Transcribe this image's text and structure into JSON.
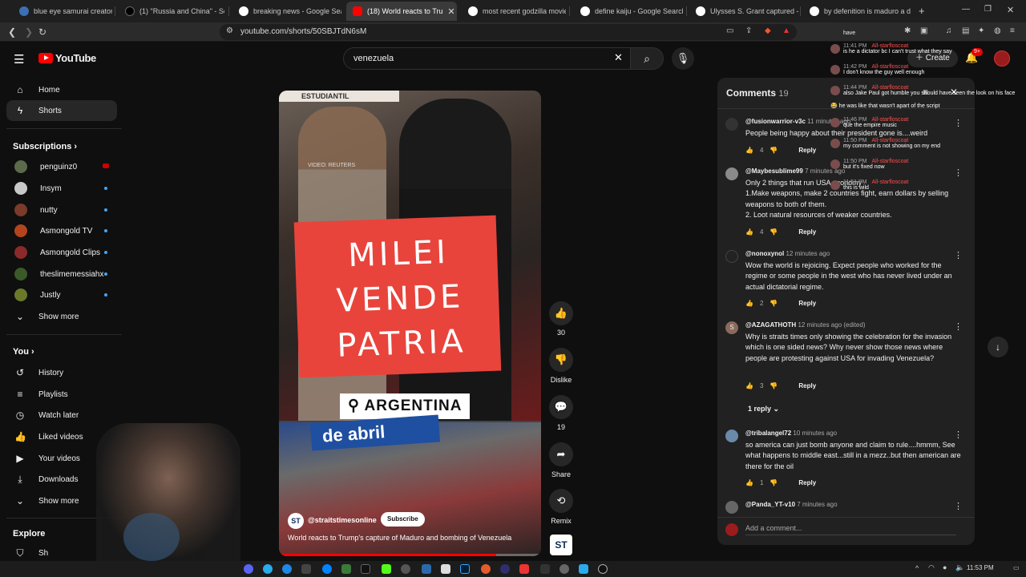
{
  "tabs": [
    {
      "label": "blue eye samurai creators also"
    },
    {
      "label": "(1) \"Russia and China\" - Search"
    },
    {
      "label": "breaking news - Google Search"
    },
    {
      "label": "(18) World reacts to Tru",
      "active": true
    },
    {
      "label": "most recent godzilla movie - G"
    },
    {
      "label": "define kaiju - Google Search"
    },
    {
      "label": "Ulysses S. Grant captured - Go"
    },
    {
      "label": "by defenition is maduro a dicta"
    }
  ],
  "address": {
    "url": "youtube.com/shorts/50SBJTdN6sM"
  },
  "header": {
    "logo_text": "YouTube",
    "search_value": "venezuela",
    "create_label": "Create",
    "notif_count": "9+"
  },
  "sidebar": {
    "main": [
      {
        "label": "Home",
        "icon": "home-icon"
      },
      {
        "label": "Shorts",
        "icon": "shorts-icon",
        "active": true
      }
    ],
    "subscriptions_title": "Subscriptions",
    "subscriptions": [
      {
        "label": "penguinz0",
        "color": "#5a6a4a",
        "live": true
      },
      {
        "label": "Insym",
        "color": "#c8c8c8"
      },
      {
        "label": "nutty",
        "color": "#7a3b2a"
      },
      {
        "label": "Asmongold TV",
        "color": "#b4441e"
      },
      {
        "label": "Asmongold Clips",
        "color": "#8a2a2a"
      },
      {
        "label": "theslimemessiahx",
        "color": "#3a5a2a"
      },
      {
        "label": "Justly",
        "color": "#6a7a2a"
      }
    ],
    "show_more": "Show more",
    "you_title": "You",
    "you": [
      {
        "label": "History",
        "icon": "history-icon"
      },
      {
        "label": "Playlists",
        "icon": "playlists-icon"
      },
      {
        "label": "Watch later",
        "icon": "watch-later-icon"
      },
      {
        "label": "Liked videos",
        "icon": "like-icon"
      },
      {
        "label": "Your videos",
        "icon": "your-videos-icon"
      },
      {
        "label": "Downloads",
        "icon": "download-icon"
      }
    ],
    "show_more_2": "Show more",
    "explore_title": "Explore",
    "explore_partial": "Sh"
  },
  "video": {
    "overlay_credit": "VIDEO: REUTERS",
    "sign_top": "ESTUDIANTIL",
    "sign_text": "MILEI VENDE PATRIA",
    "location": "ARGENTINA",
    "banner_text": "de abril",
    "channel": "@straitstimesonline",
    "subscribe": "Subscribe",
    "title": "World reacts to Trump's capture of Maduro and bombing of Venezuela"
  },
  "actions": {
    "likes": "30",
    "dislike": "Dislike",
    "comments": "19",
    "share": "Share",
    "remix": "Remix"
  },
  "comments_panel": {
    "title": "Comments",
    "count": "19",
    "add_placeholder": "Add a comment...",
    "items": [
      {
        "author": "@fusionwarrior-v3c",
        "time": "11 minutes ago",
        "text": "People being happy about their president gone is....weird",
        "likes": "4",
        "reply": "Reply",
        "avatar": "#555"
      },
      {
        "author": "@Maybesublime99",
        "time": "7 minutes ago",
        "text": "Only 2 things that run USA economy\n1.Make weapons, make 2 countries fight, earn dollars by selling weapons to both of them.\n2. Loot natural resources of weaker countries.",
        "likes": "4",
        "reply": "Reply",
        "avatar": "#8a8a8a"
      },
      {
        "author": "@nonoxynol",
        "time": "12 minutes ago",
        "text": "Wow the world is rejoicing. Expect people who worked for the regime or some people in the west who has never lived under an actual dictatorial regime.",
        "likes": "2",
        "reply": "Reply",
        "avatar": "#333"
      },
      {
        "author": "@AZAGATHOTH",
        "time": "12 minutes ago (edited)",
        "text": "Why is straits times only showing the celebration for the invasion which is one sided news? Why never show those news where people are protesting against USA for invading Venezuela?",
        "likes": "3",
        "reply": "Reply",
        "avatar": "#8a6a5a",
        "initial": "S",
        "replies": "1 reply"
      },
      {
        "author": "@tribalangel72",
        "time": "10 minutes ago",
        "text": "so america can just bomb anyone and claim to rule....hmmm, See what happens to middle east...still in a mezz..but then american are there for the oil",
        "likes": "1",
        "reply": "Reply",
        "avatar": "#6a8aaa"
      },
      {
        "author": "@Panda_YT-v10",
        "time": "7 minutes ago",
        "text": "",
        "likes": "",
        "reply": "",
        "avatar": "#666"
      }
    ]
  },
  "chat": {
    "header_word": "have",
    "messages": [
      {
        "time": "11:41 PM",
        "name": "All-starfloscoat",
        "text": "is he a dictator bc I can't trust what they say"
      },
      {
        "time": "11:42 PM",
        "name": "All-starfloscoat",
        "text": "I don't know the guy well enough"
      },
      {
        "time": "11:44 PM",
        "name": "All-starfloscoat",
        "text": "also Jake Paul got humble you should have seen the look on his face"
      },
      {
        "time": "",
        "name": "",
        "text": "he was like that wasn't apart of the script",
        "emoji": "😂"
      },
      {
        "time": "11:46 PM",
        "name": "All-starfloscoat",
        "text": "que the empire music"
      },
      {
        "time": "11:50 PM",
        "name": "All-starfloscoat",
        "text": "my comment is not showing on my end"
      },
      {
        "time": "11:50 PM",
        "name": "All-starfloscoat",
        "text": "but it's fixed now"
      },
      {
        "time": "11:51 PM",
        "name": "All-starfloscoat",
        "text": "this is wild"
      }
    ]
  },
  "taskbar": {
    "time": "11:53 PM"
  }
}
